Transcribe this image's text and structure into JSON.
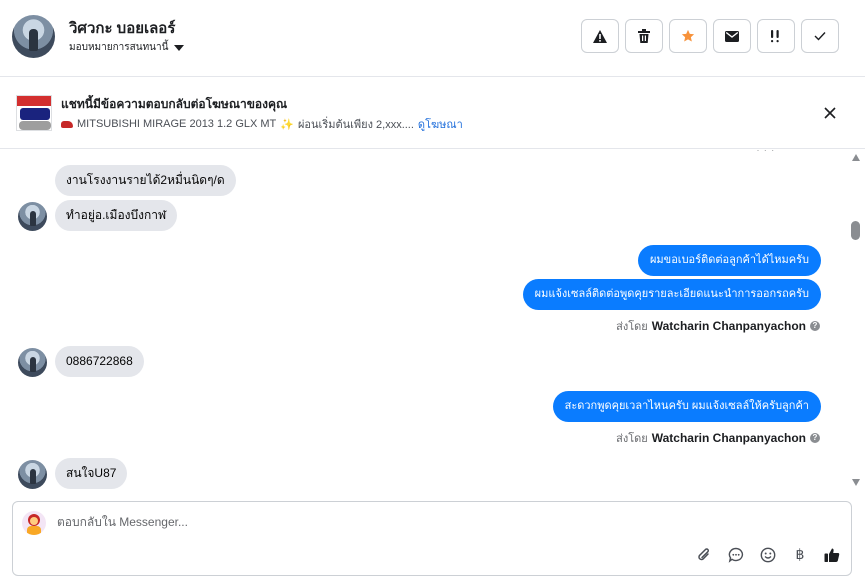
{
  "header": {
    "contact_name": "วิศวกะ บอยเลอร์",
    "assign_label": "มอบหมายการสนทนานี้",
    "toolbar": [
      {
        "name": "spam-button",
        "icon": "warning-icon"
      },
      {
        "name": "delete-button",
        "icon": "trash-icon"
      },
      {
        "name": "star-button",
        "icon": "star-icon"
      },
      {
        "name": "mark-unread-button",
        "icon": "envelope-icon"
      },
      {
        "name": "follow-up-button",
        "icon": "follow-up-icon"
      },
      {
        "name": "done-button",
        "icon": "check-icon"
      }
    ],
    "star_color": "#f7923b"
  },
  "ad_context": {
    "title": "แชทนี้มีข้อความตอบกลับต่อโฆษณาของคุณ",
    "subtitle": "MITSUBISHI MIRAGE 2013 1.2 GLX MT",
    "subtitle_more": "ผ่อนเริ่มต้นเพียง 2,xxx....",
    "link_label": "ดูโฆษณา"
  },
  "messages": [
    {
      "type": "in",
      "text": "งานโรงงานรายได้2หมื่นนิดๆ/ด"
    },
    {
      "type": "in",
      "text": "ทำอยู่อ.เมืองบึงกาฬ"
    },
    {
      "type": "out",
      "text": "ผมขอเบอร์ติดต่อลูกค้าได้ไหมครับ"
    },
    {
      "type": "out",
      "text": "ผมแจ้งเซลล์ติดต่อพูดคุยรายละเอียดแนะนำการออกรถครับ"
    },
    {
      "type": "sent_by",
      "prefix": "ส่งโดย",
      "agent": "Watcharin Chanpanyachon"
    },
    {
      "type": "in",
      "text": "0886722868"
    },
    {
      "type": "out",
      "text": "สะดวกพูดคุยเวลาไหนครับ ผมแจ้งเซลล์ให้ครับลูกค้า"
    },
    {
      "type": "sent_by",
      "prefix": "ส่งโดย",
      "agent": "Watcharin Chanpanyachon"
    },
    {
      "type": "in",
      "text": "สนใจU87"
    }
  ],
  "composer": {
    "placeholder": "ตอบกลับใน Messenger...",
    "icons": [
      "attachment-icon",
      "saved-reply-icon",
      "emoji-icon",
      "baht-icon",
      "like-icon"
    ]
  },
  "colors": {
    "outgoing_bubble": "#0a7cff",
    "incoming_bubble": "#e4e6eb",
    "link": "#216fdb"
  }
}
